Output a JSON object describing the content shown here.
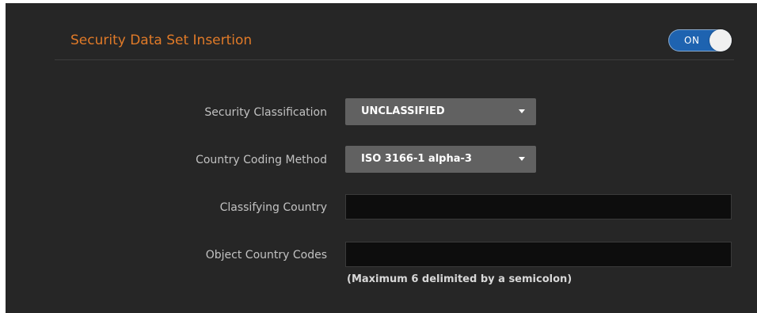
{
  "header": {
    "title": "Security Data Set Insertion",
    "toggle": {
      "label": "ON",
      "state": "on",
      "color": "#1e63b0"
    }
  },
  "form": {
    "security_classification": {
      "label": "Security Classification",
      "value": "UNCLASSIFIED"
    },
    "country_coding_method": {
      "label": "Country Coding Method",
      "value": "ISO 3166-1 alpha-3"
    },
    "classifying_country": {
      "label": "Classifying Country",
      "value": ""
    },
    "object_country_codes": {
      "label": "Object Country Codes",
      "value": "",
      "hint": "(Maximum 6 delimited by a semicolon)"
    }
  },
  "colors": {
    "title": "#e07a28",
    "panel_background": "#262626",
    "select_background": "#616161",
    "input_background": "#0d0d0d"
  }
}
